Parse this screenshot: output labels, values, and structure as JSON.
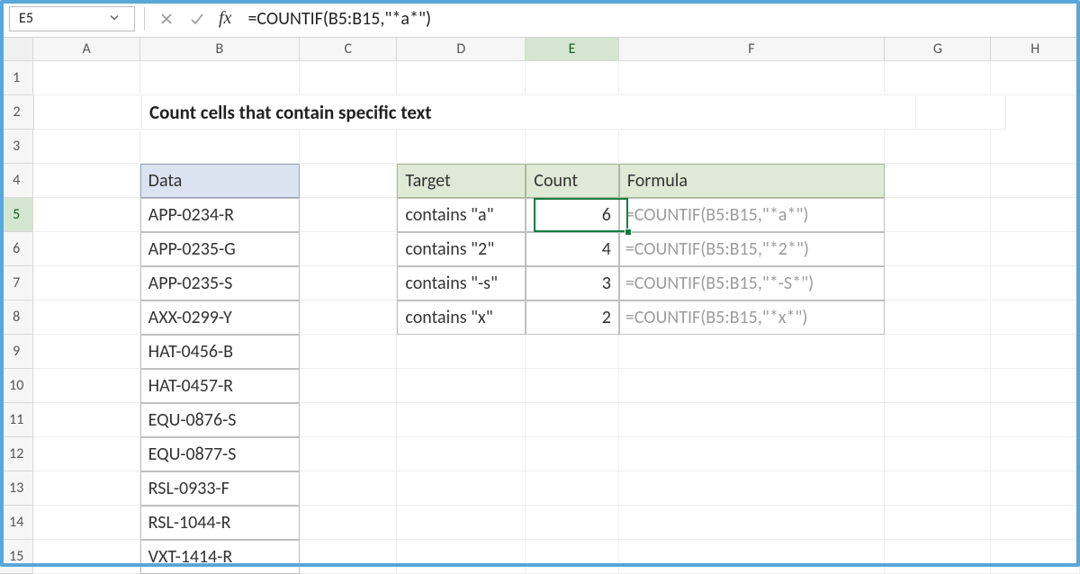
{
  "nameBox": "E5",
  "formula": "=COUNTIF(B5:B15,\"*a*\")",
  "columns": [
    "A",
    "B",
    "C",
    "D",
    "E",
    "F",
    "G",
    "H"
  ],
  "title": "Count cells that contain specific text",
  "dataHeader": "Data",
  "dataValues": [
    "APP-0234-R",
    "APP-0235-G",
    "APP-0235-S",
    "AXX-0299-Y",
    "HAT-0456-B",
    "HAT-0457-R",
    "EQU-0876-S",
    "EQU-0877-S",
    "RSL-0933-F",
    "RSL-1044-R",
    "VXT-1414-R"
  ],
  "resultHeaders": {
    "target": "Target",
    "count": "Count",
    "formula": "Formula"
  },
  "results": [
    {
      "target": "contains \"a\"",
      "count": "6",
      "formula": "=COUNTIF(B5:B15,\"*a*\")"
    },
    {
      "target": "contains \"2\"",
      "count": "4",
      "formula": "=COUNTIF(B5:B15,\"*2*\")"
    },
    {
      "target": "contains \"-s\"",
      "count": "3",
      "formula": "=COUNTIF(B5:B15,\"*-S*\")"
    },
    {
      "target": "contains \"x\"",
      "count": "2",
      "formula": "=COUNTIF(B5:B15,\"*x*\")"
    }
  ],
  "activeCell": "E5",
  "chart_data": {
    "type": "table",
    "title": "Count cells that contain specific text",
    "data_column": [
      "APP-0234-R",
      "APP-0235-G",
      "APP-0235-S",
      "AXX-0299-Y",
      "HAT-0456-B",
      "HAT-0457-R",
      "EQU-0876-S",
      "EQU-0877-S",
      "RSL-0933-F",
      "RSL-1044-R",
      "VXT-1414-R"
    ],
    "counts": [
      {
        "pattern": "*a*",
        "count": 6
      },
      {
        "pattern": "*2*",
        "count": 4
      },
      {
        "pattern": "*-S*",
        "count": 3
      },
      {
        "pattern": "*x*",
        "count": 2
      }
    ]
  }
}
